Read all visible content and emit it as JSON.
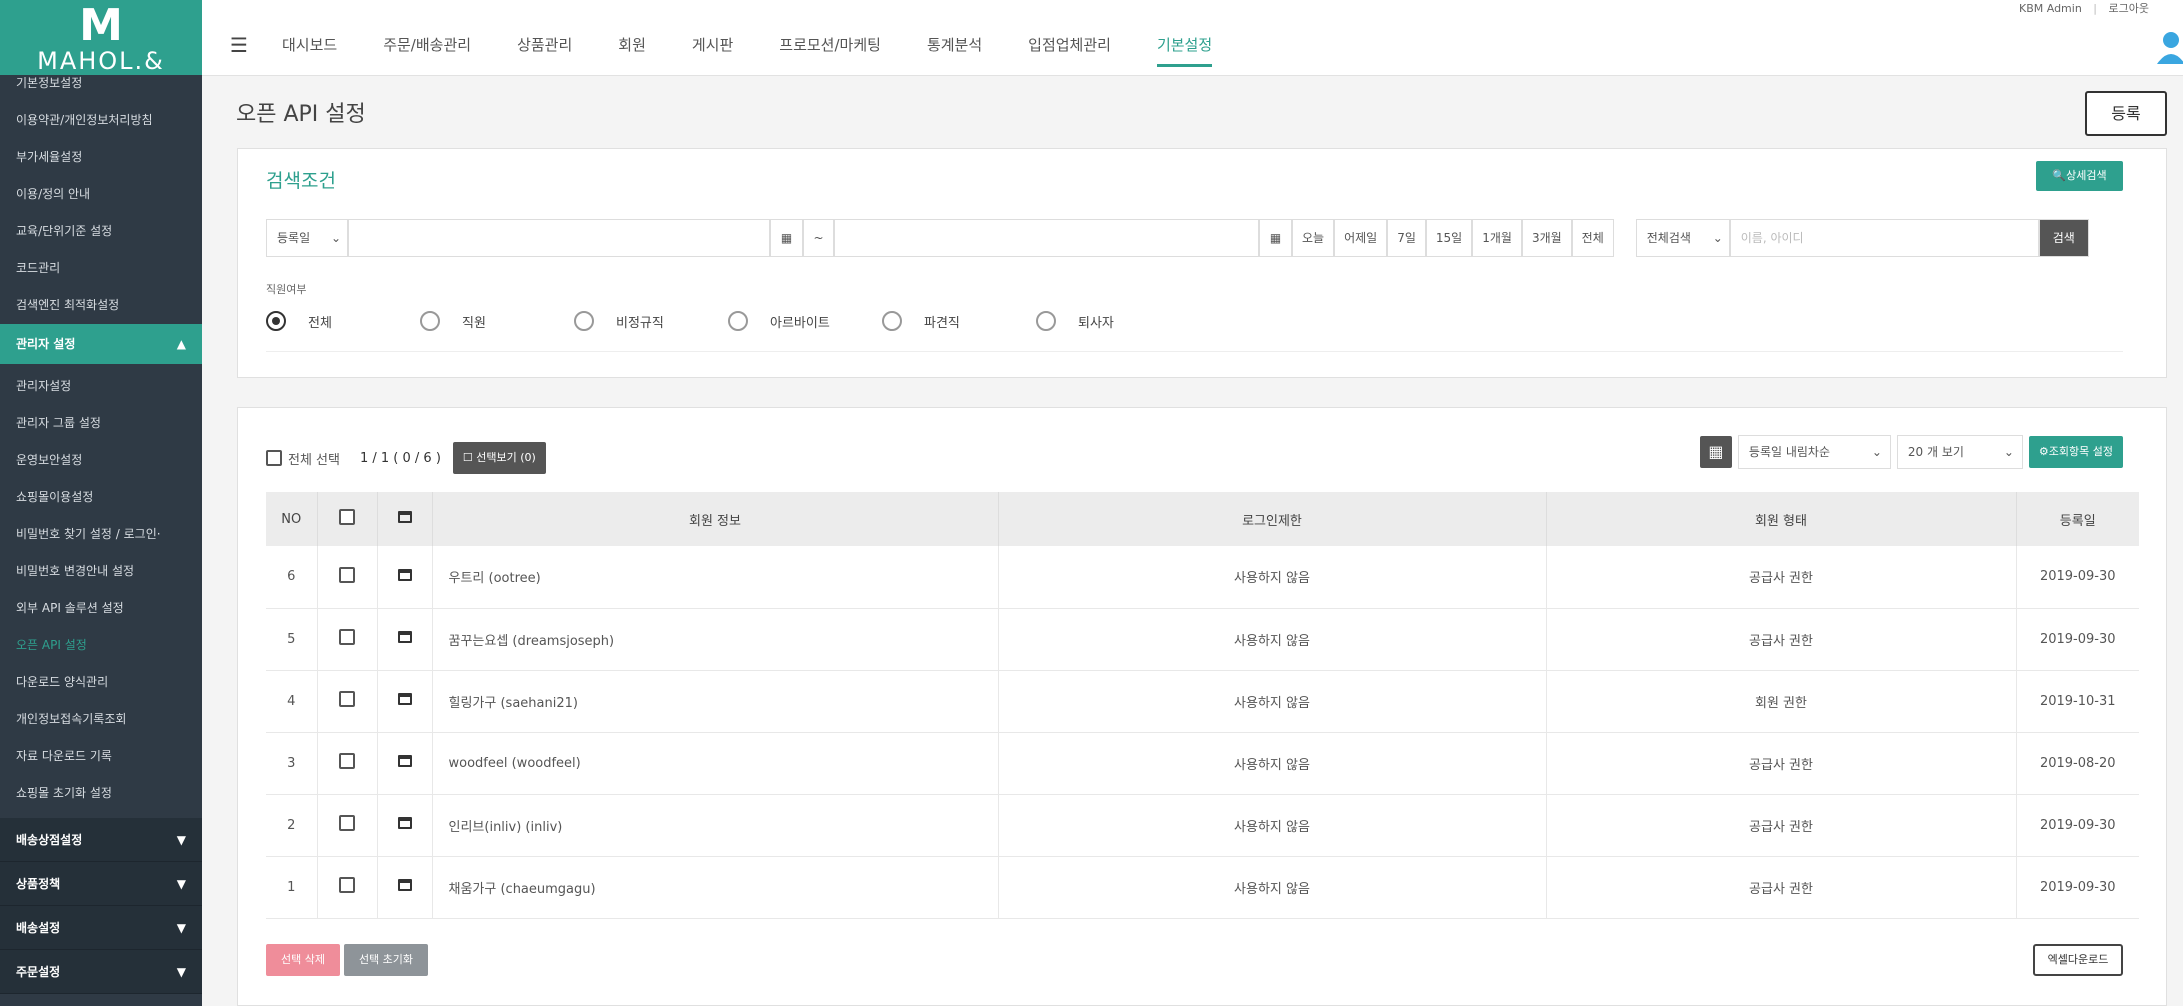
{
  "brand": {
    "logo_letter": "M",
    "logo_text": "MAHOL.&"
  },
  "top": {
    "admin": "KBM Admin",
    "divider": "|",
    "logout": "로그아웃"
  },
  "nav": [
    {
      "label": "대시보드"
    },
    {
      "label": "주문/배송관리"
    },
    {
      "label": "상품관리"
    },
    {
      "label": "회원"
    },
    {
      "label": "게시판"
    },
    {
      "label": "프로모션/마케팅"
    },
    {
      "label": "통계분석"
    },
    {
      "label": "입점업체관리"
    },
    {
      "label": "기본설정"
    }
  ],
  "sidebar": {
    "items_top": [
      "기본정보설정",
      "이용약관/개인정보처리방침",
      "부가세율설정",
      "이용/정의 안내",
      "교육/단위기준 설정",
      "코드관리",
      "검색엔진 최적화설정"
    ],
    "section_open": "관리자 설정",
    "items_admin": [
      "관리자설정",
      "관리자 그룹 설정",
      "운영보안설정",
      "쇼핑몰이용설정",
      "비밀번호 찾기 설정 / 로그인·",
      "비밀번호 변경안내 설정",
      "외부 API 솔루션 설정",
      "오픈 API 설정",
      "다운로드 양식관리",
      "개인정보접속기록조회",
      "자료 다운로드 기록",
      "쇼핑몰 초기화 설정"
    ],
    "active_index": 7,
    "sections_closed": [
      "배송상점설정",
      "상품정책",
      "배송설정",
      "주문설정"
    ]
  },
  "page": {
    "title": "오픈 API 설정",
    "register": "등록"
  },
  "search": {
    "title": "검색조건",
    "detail_btn": "🔍상세검색",
    "date_type": "등록일",
    "tilde": "~",
    "quick": [
      "오늘",
      "어제일",
      "7일",
      "15일",
      "1개월",
      "3개월",
      "전체"
    ],
    "keyword_type": "전체검색",
    "keyword_placeholder": "이름, 아이디",
    "go": "검색",
    "filter_label": "직원여부",
    "radios": [
      {
        "label": "전체",
        "checked": true
      },
      {
        "label": "직원"
      },
      {
        "label": "비정규직"
      },
      {
        "label": "아르바이트"
      },
      {
        "label": "파견직"
      },
      {
        "label": "퇴사자"
      }
    ]
  },
  "list": {
    "select_all": "전체 선택",
    "count": "1 / 1 ( 0 / 6 )",
    "view_selected": "☐ 선택보기 (0)",
    "sort": "등록일 내림차순",
    "page_size": "20 개 보기",
    "columns_btn": "⚙조회항목 설정",
    "headers": [
      "NO",
      "",
      "",
      "회원 정보",
      "로그인제한",
      "회원 형태",
      "등록일"
    ],
    "rows": [
      {
        "no": "6",
        "name": "우트리 (ootree)",
        "limit": "사용하지 않음",
        "type": "공급사 권한",
        "date": "2019-09-30"
      },
      {
        "no": "5",
        "name": "꿈꾸는요셉 (dreamsjoseph)",
        "limit": "사용하지 않음",
        "type": "공급사 권한",
        "date": "2019-09-30"
      },
      {
        "no": "4",
        "name": "힐링가구 (saehani21)",
        "limit": "사용하지 않음",
        "type": "회원 권한",
        "date": "2019-10-31"
      },
      {
        "no": "3",
        "name": "woodfeel (woodfeel)",
        "limit": "사용하지 않음",
        "type": "공급사 권한",
        "date": "2019-08-20"
      },
      {
        "no": "2",
        "name": "인리브(inliv) (inliv)",
        "limit": "사용하지 않음",
        "type": "공급사 권한",
        "date": "2019-09-30"
      },
      {
        "no": "1",
        "name": "채움가구 (chaeumgagu)",
        "limit": "사용하지 않음",
        "type": "공급사 권한",
        "date": "2019-09-30"
      }
    ],
    "delete_btn": "선택 삭제",
    "reset_btn": "선택 초기화",
    "excel_btn": "엑셀다운로드"
  }
}
